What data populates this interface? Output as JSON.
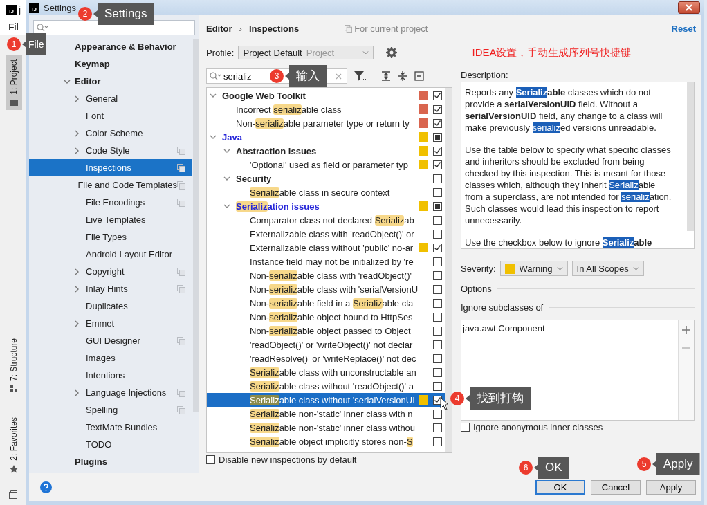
{
  "ide": {
    "logo": "IJ",
    "title": "j",
    "menu": "Fil",
    "top_tabs": [
      {
        "label": "1: Project",
        "selected": true,
        "kind": "folder"
      }
    ],
    "bottom_tabs": [
      {
        "label": "7: Structure",
        "selected": false,
        "kind": "structure"
      },
      {
        "label": "2: Favorites",
        "selected": false,
        "kind": "star"
      }
    ]
  },
  "window": {
    "logo": "IJ",
    "title": "Settings"
  },
  "sidebar": {
    "items": [
      {
        "label": "Appearance & Behavior",
        "expandable": false,
        "scoped": false,
        "selected": false
      },
      {
        "label": "Keymap",
        "expandable": false,
        "scoped": false,
        "selected": false
      },
      {
        "label": "Editor",
        "expandable": true,
        "expanded": true,
        "scoped": false,
        "selected": false,
        "children": [
          {
            "label": "General",
            "expandable": true,
            "expanded": false,
            "scoped": false,
            "selected": false
          },
          {
            "label": "Font",
            "expandable": false,
            "scoped": false,
            "selected": false
          },
          {
            "label": "Color Scheme",
            "expandable": true,
            "expanded": false,
            "scoped": false,
            "selected": false
          },
          {
            "label": "Code Style",
            "expandable": true,
            "expanded": false,
            "scoped": true,
            "selected": false
          },
          {
            "label": "Inspections",
            "expandable": false,
            "scoped": true,
            "selected": true
          },
          {
            "label": "File and Code Templates",
            "expandable": false,
            "scoped": true,
            "selected": false
          },
          {
            "label": "File Encodings",
            "expandable": false,
            "scoped": true,
            "selected": false
          },
          {
            "label": "Live Templates",
            "expandable": false,
            "scoped": false,
            "selected": false
          },
          {
            "label": "File Types",
            "expandable": false,
            "scoped": false,
            "selected": false
          },
          {
            "label": "Android Layout Editor",
            "expandable": false,
            "scoped": false,
            "selected": false
          },
          {
            "label": "Copyright",
            "expandable": true,
            "expanded": false,
            "scoped": true,
            "selected": false
          },
          {
            "label": "Inlay Hints",
            "expandable": true,
            "expanded": false,
            "scoped": true,
            "selected": false
          },
          {
            "label": "Duplicates",
            "expandable": false,
            "scoped": false,
            "selected": false
          },
          {
            "label": "Emmet",
            "expandable": true,
            "expanded": false,
            "scoped": false,
            "selected": false
          },
          {
            "label": "GUI Designer",
            "expandable": false,
            "scoped": true,
            "selected": false
          },
          {
            "label": "Images",
            "expandable": false,
            "scoped": false,
            "selected": false
          },
          {
            "label": "Intentions",
            "expandable": false,
            "scoped": false,
            "selected": false
          },
          {
            "label": "Language Injections",
            "expandable": true,
            "expanded": false,
            "scoped": true,
            "selected": false
          },
          {
            "label": "Spelling",
            "expandable": false,
            "scoped": true,
            "selected": false
          },
          {
            "label": "TextMate Bundles",
            "expandable": false,
            "scoped": false,
            "selected": false
          },
          {
            "label": "TODO",
            "expandable": false,
            "scoped": false,
            "selected": false
          }
        ]
      },
      {
        "label": "Plugins",
        "expandable": false,
        "scoped": false,
        "selected": false
      }
    ]
  },
  "header": {
    "breadcrumb": [
      "Editor",
      "Inspections"
    ],
    "separator": "›",
    "scope_note": "For current project",
    "reset": "Reset"
  },
  "profile": {
    "label": "Profile:",
    "value": "Project Default",
    "type": "Project"
  },
  "annotation": "IDEA设置，手动生成序列号快捷键",
  "search": {
    "value": "serializ"
  },
  "tree": [
    {
      "kind": "group",
      "expanded": true,
      "modified": false,
      "color": "#d9654f",
      "checked": true,
      "partial": false,
      "selected": false,
      "label": [
        {
          "text": "Google Web Toolkit"
        }
      ],
      "children": [
        {
          "kind": "inspection",
          "modified": false,
          "color": "#d9654f",
          "checked": true,
          "selected": false,
          "label": [
            {
              "text": "Incorrect "
            },
            {
              "text": "serializ",
              "match": true
            },
            {
              "text": "able class"
            }
          ]
        },
        {
          "kind": "inspection",
          "modified": false,
          "color": "#d9654f",
          "checked": true,
          "selected": false,
          "label": [
            {
              "text": "Non-"
            },
            {
              "text": "serializ",
              "match": true
            },
            {
              "text": "able parameter type or return ty"
            }
          ]
        }
      ]
    },
    {
      "kind": "group",
      "expanded": true,
      "modified": true,
      "color": "#f0c000",
      "checked": true,
      "partial": true,
      "selected": false,
      "label": [
        {
          "text": "Java"
        }
      ],
      "children": [
        {
          "kind": "group",
          "expanded": true,
          "modified": false,
          "color": "#f0c000",
          "checked": true,
          "partial": false,
          "selected": false,
          "label": [
            {
              "text": "Abstraction issues"
            }
          ],
          "children": [
            {
              "kind": "inspection",
              "modified": false,
              "color": "#f0c000",
              "checked": true,
              "selected": false,
              "label": [
                {
                  "text": "'Optional' used as field or parameter typ"
                }
              ]
            }
          ]
        },
        {
          "kind": "group",
          "expanded": true,
          "modified": false,
          "checked": false,
          "partial": false,
          "selected": false,
          "label": [
            {
              "text": "Security"
            }
          ],
          "children": [
            {
              "kind": "inspection",
              "modified": false,
              "checked": false,
              "selected": false,
              "label": [
                {
                  "text": "Serializ",
                  "match": true
                },
                {
                  "text": "able class in secure context"
                }
              ]
            }
          ]
        },
        {
          "kind": "group",
          "expanded": true,
          "modified": true,
          "color": "#f0c000",
          "checked": true,
          "partial": true,
          "selected": false,
          "label": [
            {
              "text": "Serializ",
              "match": true
            },
            {
              "text": "ation issues"
            }
          ],
          "children": [
            {
              "kind": "inspection",
              "modified": false,
              "checked": false,
              "selected": false,
              "label": [
                {
                  "text": "Comparator class not declared "
                },
                {
                  "text": "Serializ",
                  "match": true
                },
                {
                  "text": "ab"
                }
              ]
            },
            {
              "kind": "inspection",
              "modified": false,
              "checked": false,
              "selected": false,
              "label": [
                {
                  "text": "Externalizable class with 'readObject()' or"
                }
              ]
            },
            {
              "kind": "inspection",
              "modified": false,
              "color": "#f0c000",
              "checked": true,
              "selected": false,
              "label": [
                {
                  "text": "Externalizable class without 'public' no-ar"
                }
              ]
            },
            {
              "kind": "inspection",
              "modified": false,
              "checked": false,
              "selected": false,
              "label": [
                {
                  "text": "Instance field may not be initialized by 're"
                }
              ]
            },
            {
              "kind": "inspection",
              "modified": false,
              "checked": false,
              "selected": false,
              "label": [
                {
                  "text": "Non-"
                },
                {
                  "text": "serializ",
                  "match": true
                },
                {
                  "text": "able class with 'readObject()'"
                }
              ]
            },
            {
              "kind": "inspection",
              "modified": false,
              "checked": false,
              "selected": false,
              "label": [
                {
                  "text": "Non-"
                },
                {
                  "text": "serializ",
                  "match": true
                },
                {
                  "text": "able class with 'serialVersionU"
                }
              ]
            },
            {
              "kind": "inspection",
              "modified": false,
              "checked": false,
              "selected": false,
              "label": [
                {
                  "text": "Non-"
                },
                {
                  "text": "serializ",
                  "match": true
                },
                {
                  "text": "able field in a "
                },
                {
                  "text": "Serializ",
                  "match": true
                },
                {
                  "text": "able cla"
                }
              ]
            },
            {
              "kind": "inspection",
              "modified": false,
              "checked": false,
              "selected": false,
              "label": [
                {
                  "text": "Non-"
                },
                {
                  "text": "serializ",
                  "match": true
                },
                {
                  "text": "able object bound to HttpSes"
                }
              ]
            },
            {
              "kind": "inspection",
              "modified": false,
              "checked": false,
              "selected": false,
              "label": [
                {
                  "text": "Non-"
                },
                {
                  "text": "serializ",
                  "match": true
                },
                {
                  "text": "able object passed to Object"
                }
              ]
            },
            {
              "kind": "inspection",
              "modified": false,
              "checked": false,
              "selected": false,
              "label": [
                {
                  "text": "'readObject()' or 'writeObject()' not declar"
                }
              ]
            },
            {
              "kind": "inspection",
              "modified": false,
              "checked": false,
              "selected": false,
              "label": [
                {
                  "text": "'readResolve()' or 'writeReplace()' not dec"
                }
              ]
            },
            {
              "kind": "inspection",
              "modified": false,
              "checked": false,
              "selected": false,
              "label": [
                {
                  "text": "Serializ",
                  "match": true
                },
                {
                  "text": "able class with unconstructable an"
                }
              ]
            },
            {
              "kind": "inspection",
              "modified": false,
              "checked": false,
              "selected": false,
              "label": [
                {
                  "text": "Serializ",
                  "match": true
                },
                {
                  "text": "able class without 'readObject()' a"
                }
              ]
            },
            {
              "kind": "inspection",
              "modified": false,
              "color": "#f0c000",
              "checked": true,
              "selected": true,
              "label": [
                {
                  "text": "Serializ",
                  "match": true
                },
                {
                  "text": "able class without 'serialVersionUI"
                }
              ]
            },
            {
              "kind": "inspection",
              "modified": false,
              "checked": false,
              "selected": false,
              "label": [
                {
                  "text": "Serializ",
                  "match": true
                },
                {
                  "text": "able non-'static' inner class with n"
                }
              ]
            },
            {
              "kind": "inspection",
              "modified": false,
              "checked": false,
              "selected": false,
              "label": [
                {
                  "text": "Serializ",
                  "match": true
                },
                {
                  "text": "able non-'static' inner class withou"
                }
              ]
            },
            {
              "kind": "inspection",
              "modified": false,
              "checked": false,
              "selected": false,
              "label": [
                {
                  "text": "Serializ",
                  "match": true
                },
                {
                  "text": "able object implicitly stores non-"
                },
                {
                  "text": "S",
                  "match": true
                }
              ]
            }
          ]
        }
      ]
    }
  ],
  "disable_new": {
    "label": "Disable new inspections by default",
    "checked": false
  },
  "description": {
    "title": "Description:",
    "paragraphs": [
      [
        {
          "text": "Reports any "
        },
        {
          "text": "Serializ",
          "match": true,
          "bold": true
        },
        {
          "text": "able",
          "bold": true
        },
        {
          "text": " classes which do not provide a "
        },
        {
          "text": "serialVersionUID",
          "bold": true
        },
        {
          "text": " field. Without a "
        },
        {
          "text": "serialVersionUID",
          "bold": true
        },
        {
          "text": " field, any change to a class will make previously "
        },
        {
          "text": "serializ",
          "match": true
        },
        {
          "text": "ed versions unreadable."
        }
      ],
      [
        {
          "text": "Use the table below to specify what specific classes and inheritors should be excluded from being checked by this inspection. This is meant for those classes which, although they inherit "
        },
        {
          "text": "Serializ",
          "match": true
        },
        {
          "text": "able from a superclass, are not intended for "
        },
        {
          "text": "serializ",
          "match": true
        },
        {
          "text": "ation. Such classes would lead this inspection to report unnecessarily."
        }
      ],
      [
        {
          "text": "Use the checkbox below to ignore "
        },
        {
          "text": "Serializ",
          "match": true,
          "bold": true
        },
        {
          "text": "able",
          "bold": true
        }
      ]
    ]
  },
  "severity": {
    "label": "Severity:",
    "value": "Warning",
    "color": "#f0c000",
    "scope": "In All Scopes"
  },
  "options": {
    "title": "Options",
    "ignore_title": "Ignore subclasses of",
    "ignore_list": [
      "java.awt.Component"
    ],
    "anonymous": {
      "label": "Ignore anonymous inner classes",
      "checked": false
    }
  },
  "buttons": [
    {
      "label": "OK",
      "default": true
    },
    {
      "label": "Cancel",
      "default": false
    },
    {
      "label": "Apply",
      "default": false
    }
  ],
  "callouts": [
    {
      "number": "2",
      "text": "Settings"
    },
    {
      "number": "1",
      "text": "File"
    },
    {
      "number": "3",
      "text": "输入"
    },
    {
      "number": "4",
      "text": "找到打钩"
    },
    {
      "number": "6",
      "text": "OK"
    },
    {
      "number": "5",
      "text": "Apply"
    }
  ]
}
